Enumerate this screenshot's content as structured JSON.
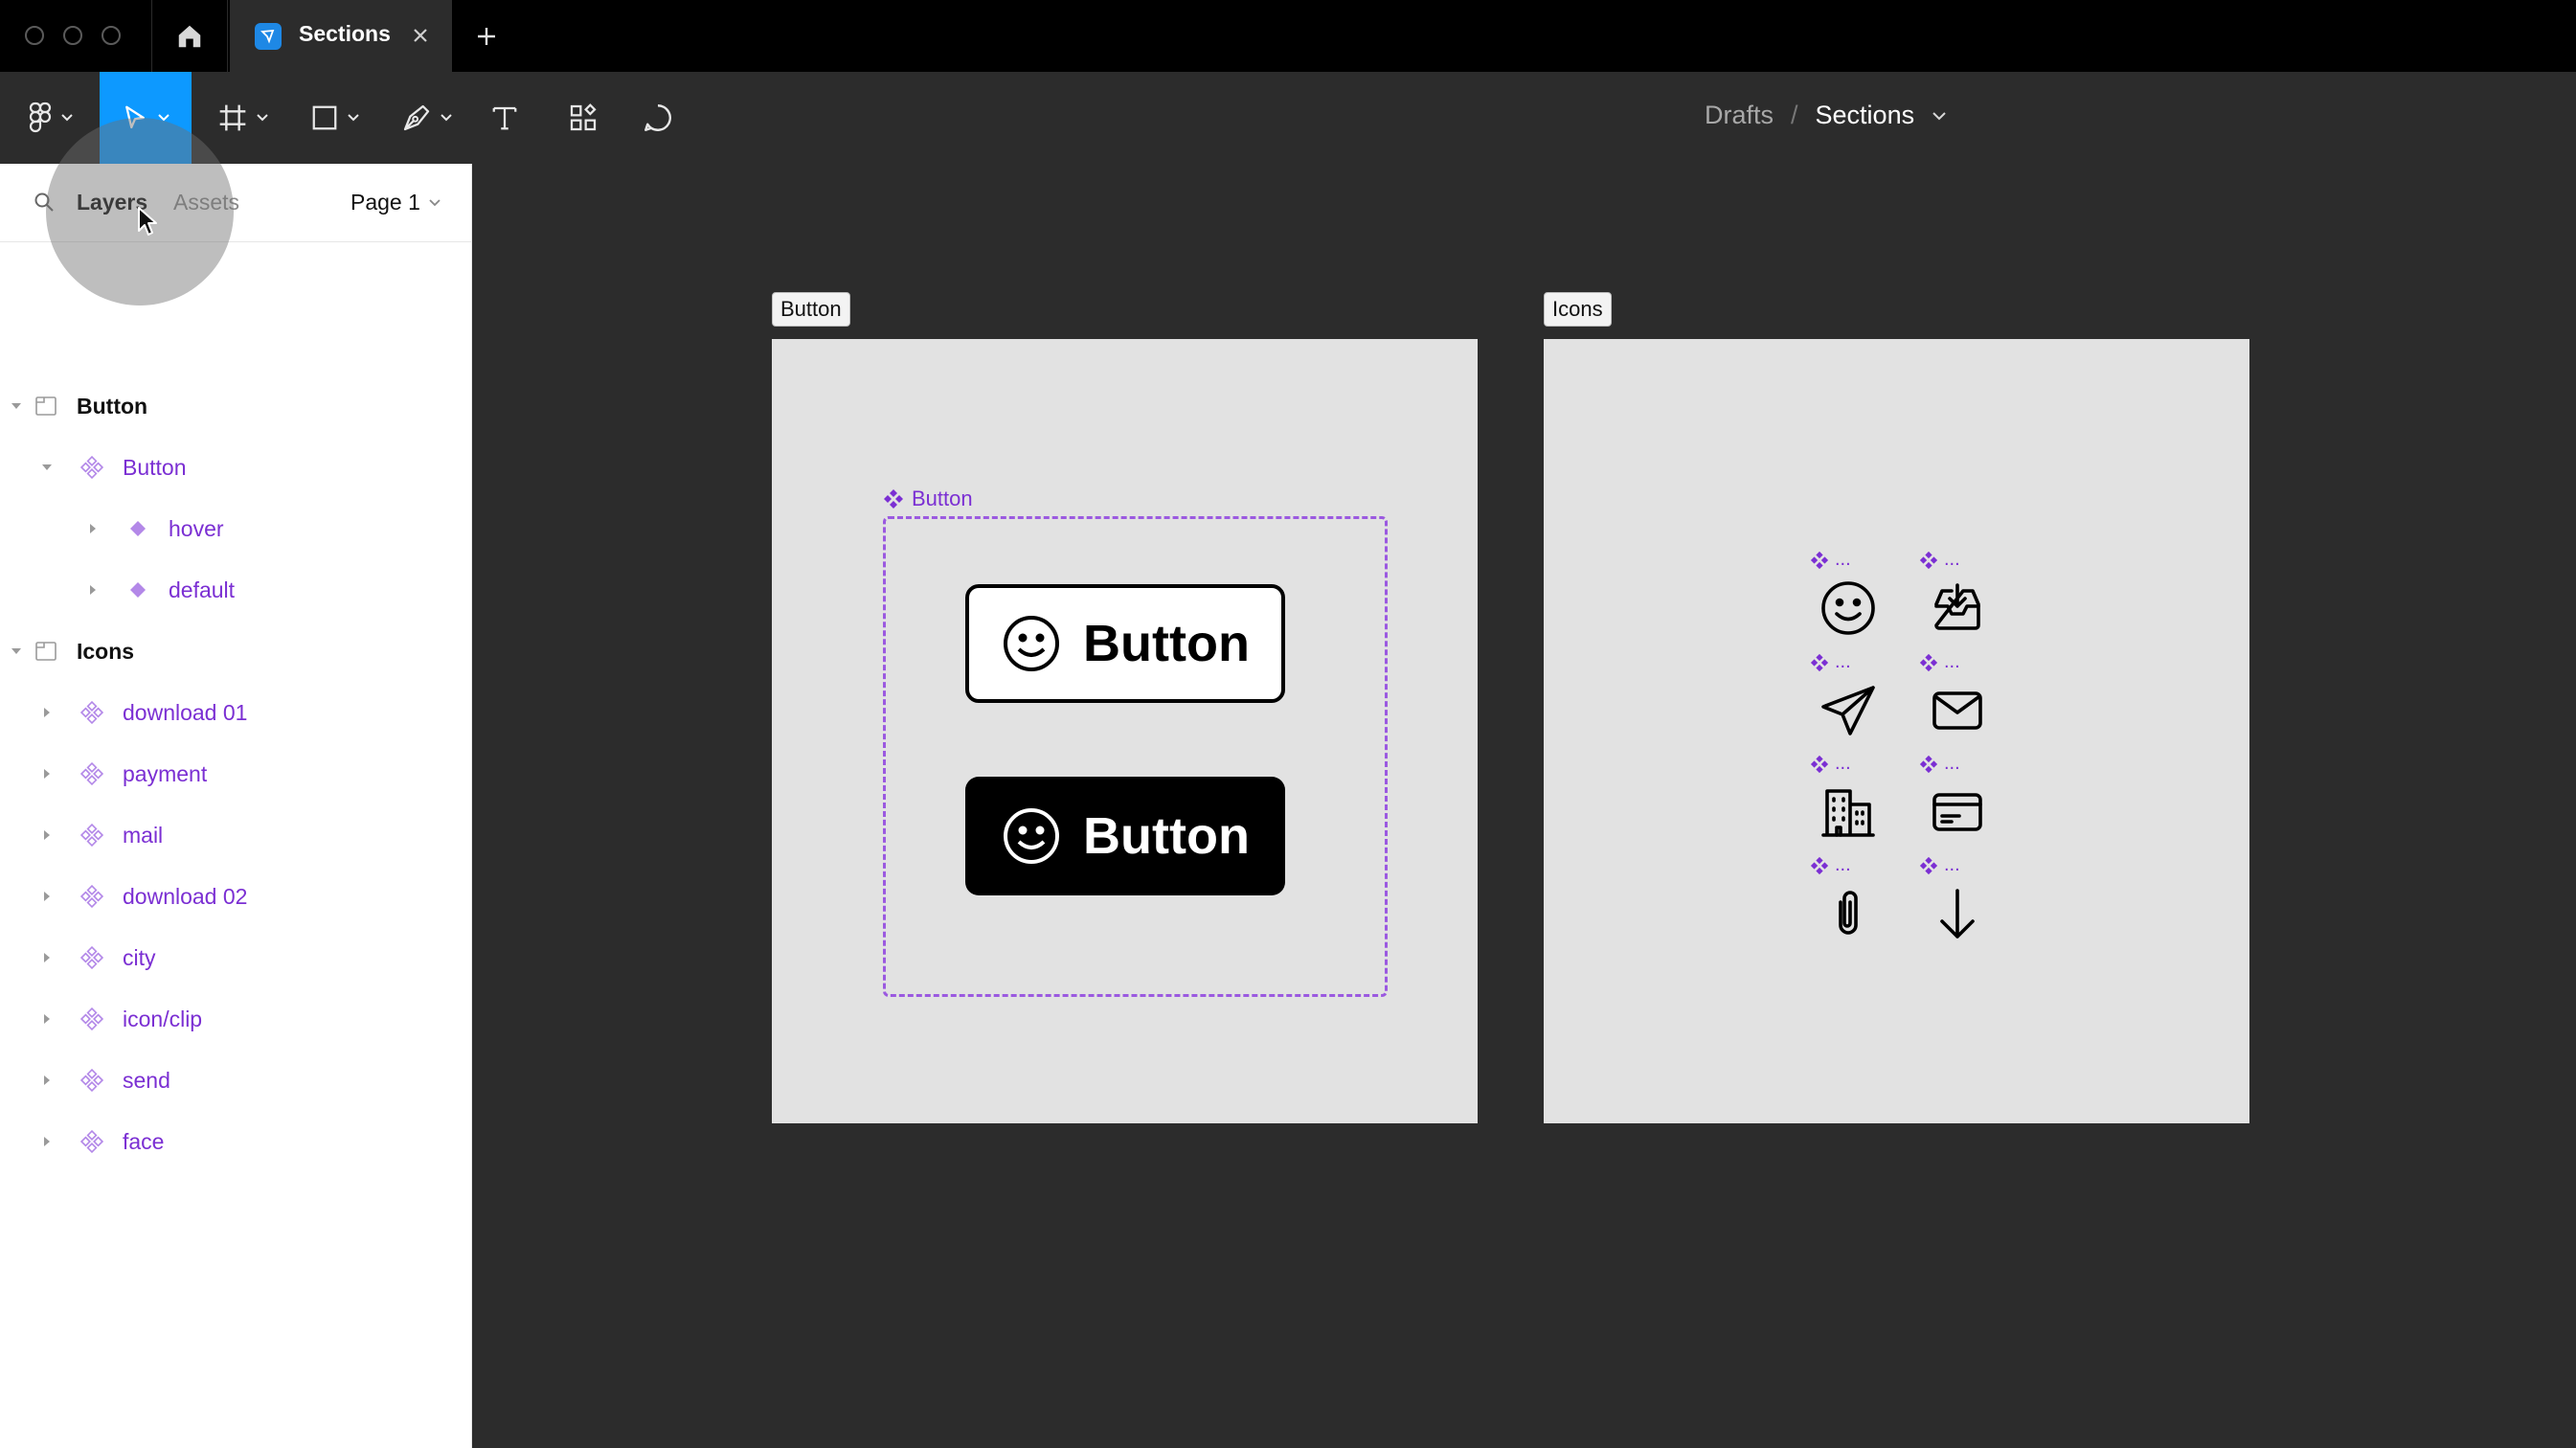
{
  "app": {
    "tab_title": "Sections"
  },
  "breadcrumb": {
    "folder": "Drafts",
    "separator": "/",
    "file": "Sections"
  },
  "panel": {
    "tabs": {
      "layers": "Layers",
      "assets": "Assets"
    },
    "page_selector": "Page 1",
    "layers": [
      {
        "label": "Button",
        "kind": "section",
        "depth": 0,
        "expanded": true
      },
      {
        "label": "Button",
        "kind": "component-set",
        "depth": 1,
        "expanded": true
      },
      {
        "label": "hover",
        "kind": "variant",
        "depth": 2,
        "expanded": false
      },
      {
        "label": "default",
        "kind": "variant",
        "depth": 2,
        "expanded": false
      },
      {
        "label": "Icons",
        "kind": "section",
        "depth": 0,
        "expanded": true
      },
      {
        "label": "download 01",
        "kind": "component",
        "depth": 1,
        "expanded": false
      },
      {
        "label": "payment",
        "kind": "component",
        "depth": 1,
        "expanded": false
      },
      {
        "label": "mail",
        "kind": "component",
        "depth": 1,
        "expanded": false
      },
      {
        "label": "download 02",
        "kind": "component",
        "depth": 1,
        "expanded": false
      },
      {
        "label": "city",
        "kind": "component",
        "depth": 1,
        "expanded": false
      },
      {
        "label": "icon/clip",
        "kind": "component",
        "depth": 1,
        "expanded": false
      },
      {
        "label": "send",
        "kind": "component",
        "depth": 1,
        "expanded": false
      },
      {
        "label": "face",
        "kind": "component",
        "depth": 1,
        "expanded": false
      }
    ]
  },
  "canvas": {
    "button_section": {
      "label": "Button",
      "component_set_label": "Button",
      "buttons": [
        {
          "label": "Button",
          "variant": "light",
          "icon": "smiley-icon"
        },
        {
          "label": "Button",
          "variant": "dark",
          "icon": "smiley-icon"
        }
      ]
    },
    "icons_section": {
      "label": "Icons",
      "instance_tag": "...",
      "icons": [
        "face-icon",
        "download-tray-icon",
        "send-icon",
        "mail-icon",
        "city-icon",
        "payment-card-icon",
        "clip-icon",
        "arrow-down-icon"
      ]
    }
  },
  "colors": {
    "accent": "#0d99ff",
    "component": "#7b2fd3",
    "canvas_bg": "#2c2c2c",
    "frame_bg": "#e2e2e2"
  }
}
